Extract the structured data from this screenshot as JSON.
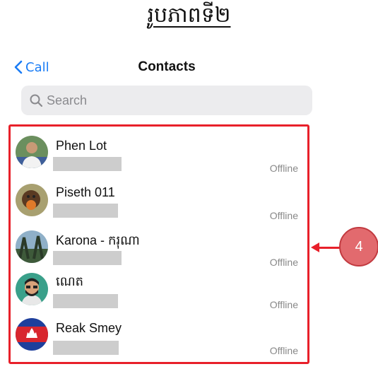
{
  "page_title": "រូបភាពទី២",
  "nav": {
    "back_label": "Call",
    "title": "Contacts"
  },
  "search": {
    "placeholder": "Search"
  },
  "contacts": [
    {
      "name": "Phen Lot",
      "status": "Offline"
    },
    {
      "name": "Piseth 011",
      "status": "Offline"
    },
    {
      "name": "Karona - ករុណា",
      "status": "Offline"
    },
    {
      "name": "ណេត",
      "status": "Offline"
    },
    {
      "name": "Reak Smey",
      "status": "Offline"
    }
  ],
  "callout": {
    "number": "4"
  },
  "colors": {
    "accent": "#1a7cf5",
    "highlight": "#e8202a",
    "callout_fill": "#e26a6e",
    "redaction": "#cdcdcd"
  }
}
